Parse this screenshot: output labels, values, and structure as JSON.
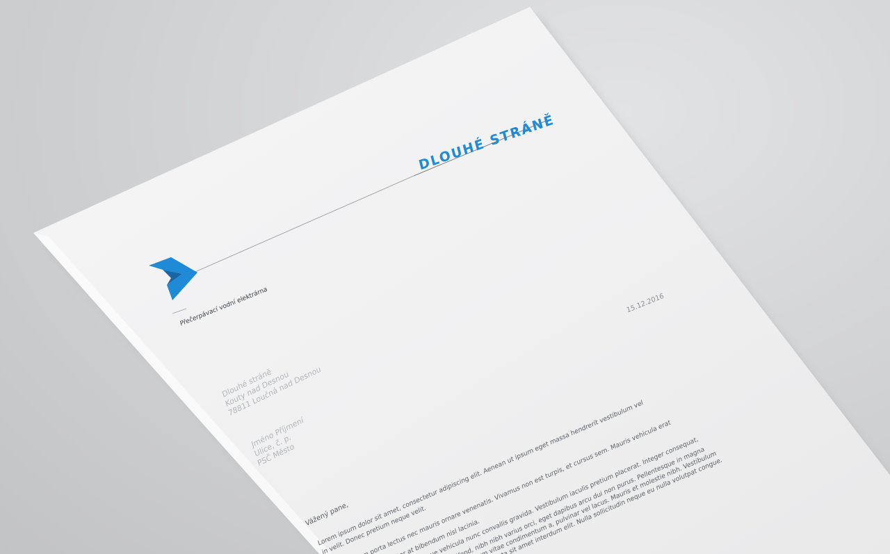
{
  "letterhead": {
    "brand_title": "DLOUHÉ STRÁNĚ",
    "tagline": "Přečerpávací vodní elektrárna",
    "date": "15.12.2016",
    "brand_color": "#1f8ad6"
  },
  "sender": {
    "line1": "Dlouhé stráně",
    "line2": "Kouty nad Desnou",
    "line3": "78811 Loučná nad Desnou"
  },
  "recipient": {
    "line1": "Jméno Příjmení",
    "line2": "Ulice, č. p.",
    "line3": "PSČ Město"
  },
  "letter": {
    "greeting": "Vážený pane,",
    "para1_line1": "Lorem ipsum dolor sit amet, consectetur adipiscing elit. Aenean ut ipsum eget massa hendrerit vestibulum vel",
    "para1_line2": "in velit. Donec pretium neque velit.",
    "para2_line1": "am porta lectus nec mauris ornare venenatis. Vivamus non est turpis, et cursus sem. Mauris vehicula erat",
    "para2_line2": "uctor at bibendum nisl lacinia.",
    "para3_line1": "que vehicula nunc convallis gravida. Vestibulum iaculis pretium placerat. Integer consequat,",
    "para3_line2": "eifend, nibh nibh varius orci, eget dapibus arcu dui non purus. Pellentesque in magna",
    "para3_line3": "ictum vitae condimentum a, pulvinar vel lacus. Mauris et molestie nibh. Vestibulum",
    "para3_line4": "porta sit amet interdum elit. Nulla sollicitudin neque eu nulla volutpat congue."
  },
  "icons": {
    "logo": "chevron-logo-icon"
  }
}
